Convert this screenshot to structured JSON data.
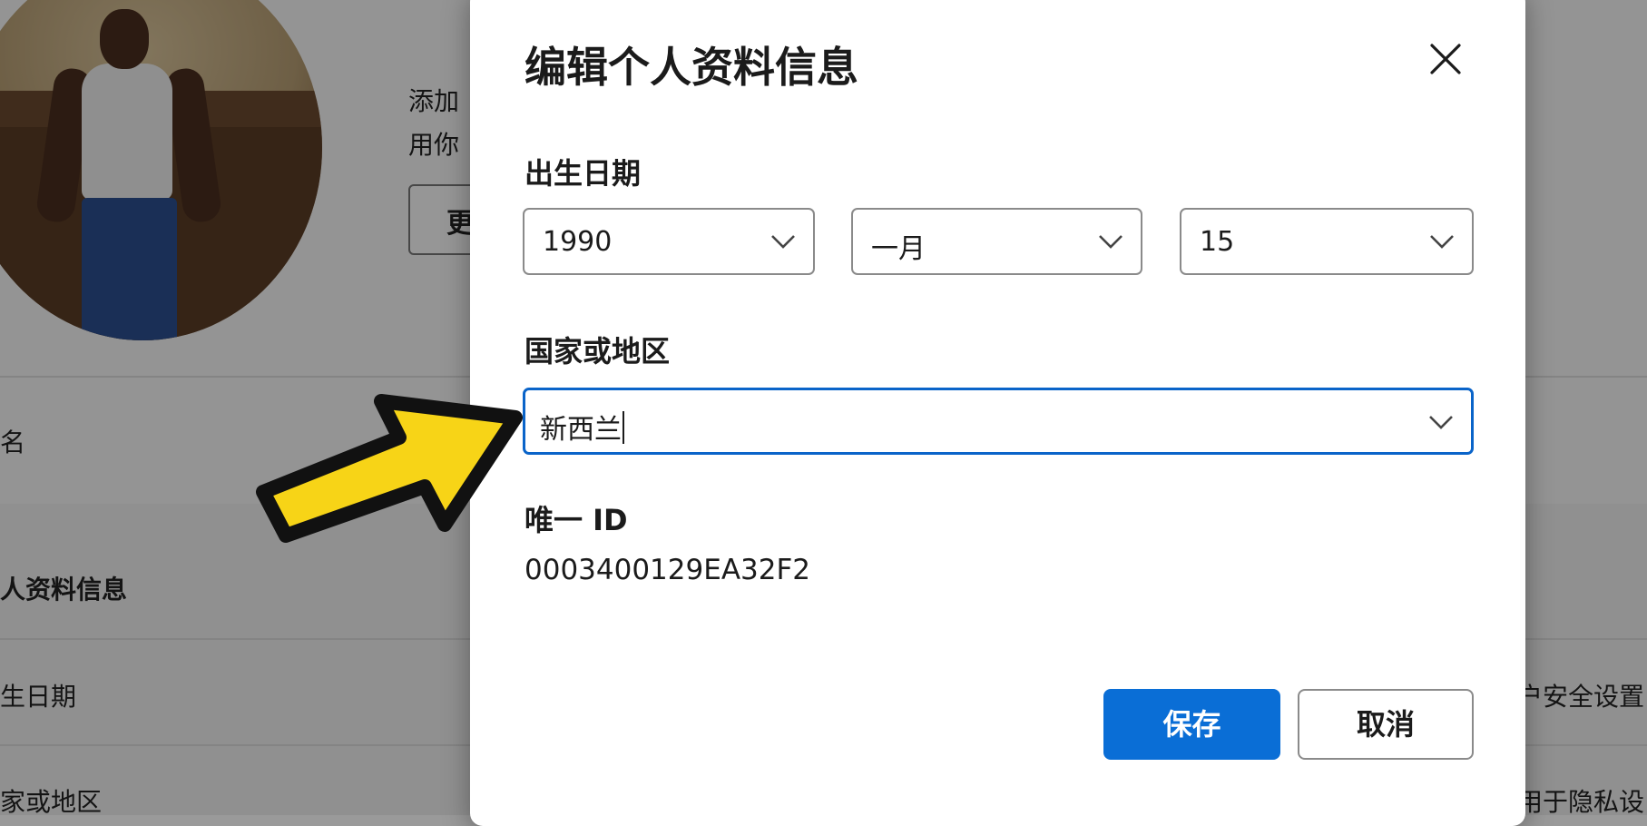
{
  "background": {
    "intro_line1": "添加",
    "intro_line2": "用你",
    "change_button": "更",
    "name_row": "名",
    "section_title": "人资料信息",
    "dob_row": "生日期",
    "country_row": "家或地区",
    "right_row1": "户安全设置",
    "right_row2": "用于隐私设"
  },
  "dialog": {
    "title": "编辑个人资料信息",
    "close_icon": "close-icon",
    "dob": {
      "label": "出生日期",
      "year": "1990",
      "month": "一月",
      "day": "15"
    },
    "country": {
      "label": "国家或地区",
      "value": "新西兰"
    },
    "uid": {
      "label": "唯一 ID",
      "value": "0003400129EA32F2"
    },
    "save_label": "保存",
    "cancel_label": "取消"
  },
  "colors": {
    "primary": "#0a6ed6",
    "focus_border": "#0a64c9",
    "arrow_fill": "#f7d417",
    "arrow_outline": "#111111"
  }
}
